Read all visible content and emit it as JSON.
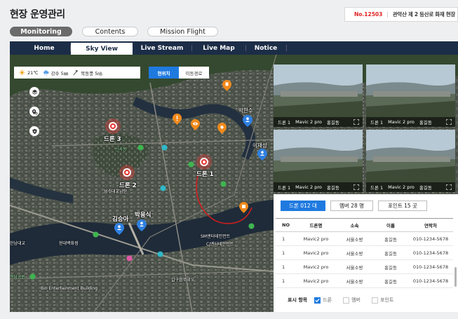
{
  "header": {
    "title": "현장 운영관리",
    "incident_no": "No.12503",
    "incident_desc": "관악산 제 2 등산로 화재 현장"
  },
  "modes": [
    {
      "label": "Monitoring",
      "active": true
    },
    {
      "label": "Contents",
      "active": false
    },
    {
      "label": "Mission Flight",
      "active": false
    }
  ],
  "nav": [
    {
      "label": "Home",
      "active": false
    },
    {
      "label": "Sky View",
      "active": true
    },
    {
      "label": "Live Stream",
      "active": false
    },
    {
      "label": "Live Map",
      "active": false
    },
    {
      "label": "Notice",
      "active": false
    }
  ],
  "weather": {
    "temp": "21℃",
    "rain": "강수 5㎜",
    "wind": "북동풍 5㎧"
  },
  "location_toggle": {
    "current": "현위치",
    "route": "이동경로"
  },
  "map_labels": {
    "drone3": "드론 3",
    "drone2": "드론 2",
    "drone1": "드론 1",
    "person_kim": "김승아",
    "person_park": "박용식",
    "person_lee": "이재성",
    "person_park2": "박현수",
    "place1": "성수대교남단",
    "place2": "현대백화점",
    "place3": "압구정로데오",
    "place4": "SM엔터테인먼트",
    "place5": "CJ엔터테인먼트",
    "place6": "한남대교",
    "place7": "Bin Entertainment Building",
    "place8": "신사동",
    "place9": "청담공원"
  },
  "cameras": [
    {
      "drone": "드론 1",
      "model": "Mavic 2 pro",
      "pilot": "홍길동"
    },
    {
      "drone": "드론 1",
      "model": "Mavic 2 pro",
      "pilot": "홍길동"
    },
    {
      "drone": "드론 1",
      "model": "Mavic 2 pro",
      "pilot": "홍길동"
    },
    {
      "drone": "드론 1",
      "model": "Mavic 2 pro",
      "pilot": "홍길동"
    }
  ],
  "panel": {
    "chips": [
      {
        "label": "드론 012 대",
        "active": true
      },
      {
        "label": "멤버 28 명",
        "active": false
      },
      {
        "label": "포인트 15 곳",
        "active": false
      }
    ],
    "columns": [
      "NO",
      "드론명",
      "소속",
      "이름",
      "연락처"
    ],
    "rows": [
      [
        "1",
        "Mavic2 pro",
        "서울소방",
        "홍길동",
        "010-1234-5678"
      ],
      [
        "1",
        "Mavic2 pro",
        "서울소방",
        "홍길동",
        "010-1234-5678"
      ],
      [
        "1",
        "Mavic2 pro",
        "서울소방",
        "홍길동",
        "010-1234-5678"
      ],
      [
        "1",
        "Mavic2 pro",
        "서울소방",
        "홍길동",
        "010-1234-5678"
      ]
    ],
    "legend_title": "표시 항목",
    "legend": [
      {
        "label": "드론",
        "checked": true
      },
      {
        "label": "멤버",
        "checked": false
      },
      {
        "label": "포인트",
        "checked": false
      }
    ]
  },
  "colors": {
    "navy": "#1c2d47",
    "accent_blue": "#1f7ae0",
    "alert_red": "#e02020",
    "drone_red": "#e8322e",
    "poi_orange": "#f08a1c"
  }
}
